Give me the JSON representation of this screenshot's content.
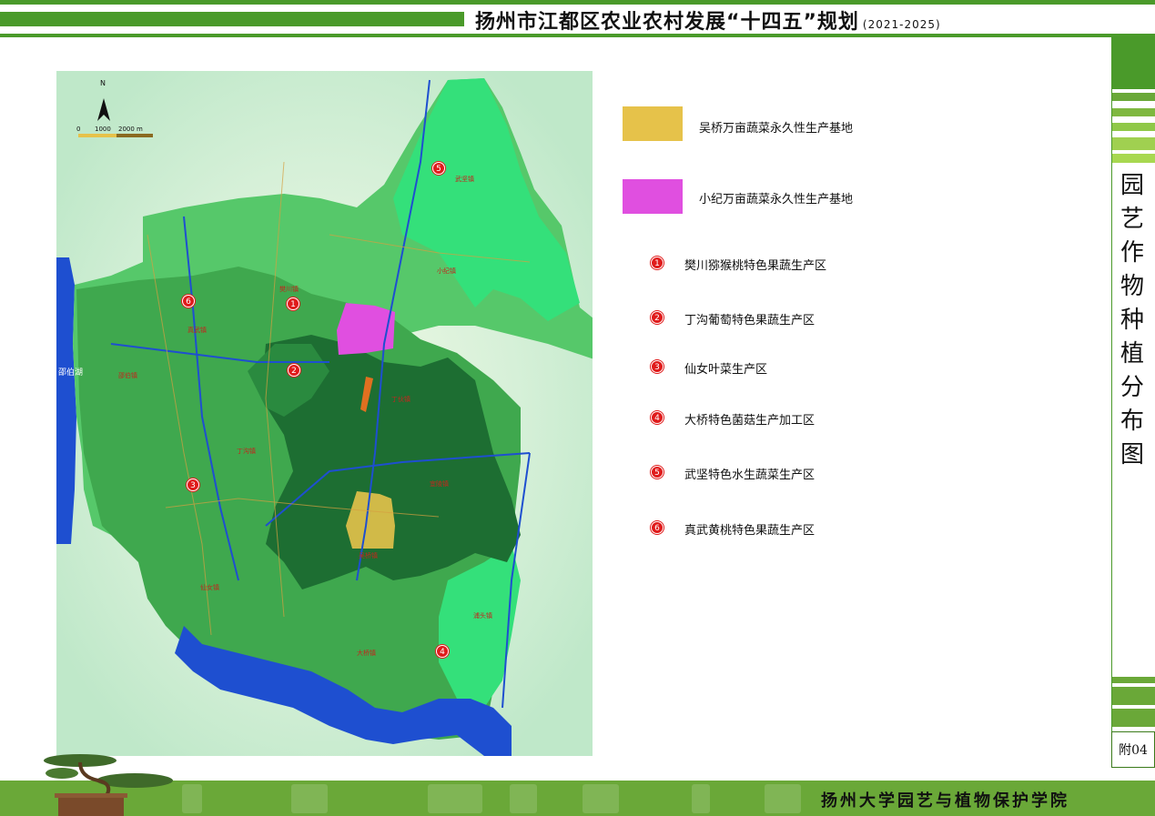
{
  "header": {
    "title": "扬州市江都区农业农村发展“十四五”规划",
    "subtitle": "(2021-2025)"
  },
  "map": {
    "compass_label": "N",
    "scale_labels": [
      "0",
      "1000",
      "2000 m"
    ],
    "lake_label": "邵伯湖",
    "towns": [
      "樊川镇",
      "武坚镇",
      "小纪镇",
      "真武镇",
      "邵伯镇",
      "丁沟镇",
      "宜陵镇",
      "仙女镇",
      "大桥镇",
      "浦头镇",
      "丁伙镇",
      "吴桥镇"
    ],
    "markers": [
      "1",
      "2",
      "3",
      "4",
      "5",
      "6"
    ]
  },
  "legend": {
    "bases": [
      {
        "label": "吴桥万亩蔬菜永久性生产基地",
        "color": "#e6c24a"
      },
      {
        "label": "小纪万亩蔬菜永久性生产基地",
        "color": "#e04fe0"
      }
    ],
    "zones": [
      {
        "num": "1",
        "label": "樊川猕猴桃特色果蔬生产区"
      },
      {
        "num": "2",
        "label": "丁沟葡萄特色果蔬生产区"
      },
      {
        "num": "3",
        "label": "仙女叶菜生产区"
      },
      {
        "num": "4",
        "label": "大桥特色菌菇生产加工区"
      },
      {
        "num": "5",
        "label": "武坚特色水生蔬菜生产区"
      },
      {
        "num": "6",
        "label": "真武黄桃特色果蔬生产区"
      }
    ]
  },
  "side": {
    "title_chars": [
      "园",
      "艺",
      "作",
      "物",
      "种",
      "植",
      "分",
      "布",
      "图"
    ],
    "page_label": "附04"
  },
  "footer": {
    "institution": "扬州大学园艺与植物保护学院"
  },
  "colors": {
    "brand_green": "#4a9a2a",
    "marker_red": "#e01b1b",
    "water_blue": "#1e4fd0"
  }
}
